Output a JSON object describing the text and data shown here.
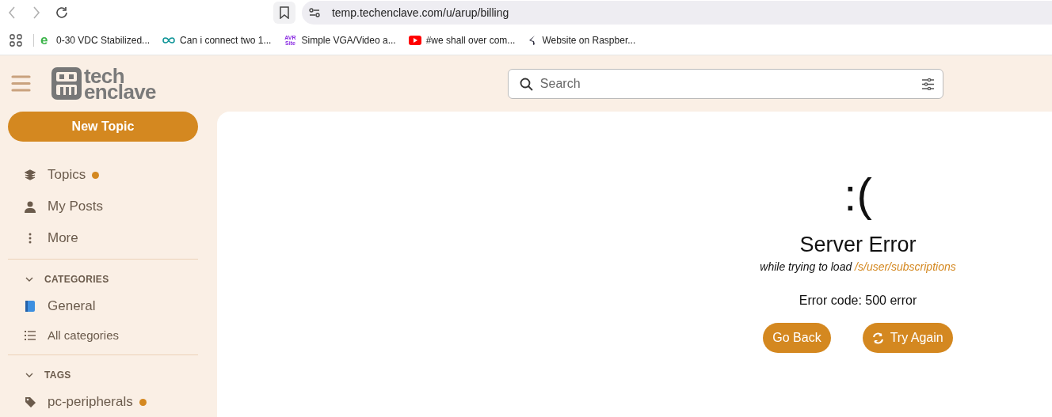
{
  "browser": {
    "url": "temp.techenclave.com/u/arup/billing"
  },
  "bookmarks": [
    {
      "kind": "letter",
      "icon_text": "e",
      "label": "0-30 VDC Stabilized..."
    },
    {
      "kind": "infinity",
      "label": "Can i connect two 1..."
    },
    {
      "kind": "letter2",
      "icon_text": "AVR Site",
      "label": "Simple VGA/Video a..."
    },
    {
      "kind": "play",
      "label": "#we shall over com..."
    },
    {
      "kind": "bird",
      "label": "Website on Raspber..."
    }
  ],
  "header": {
    "logo_top": "tech",
    "logo_bottom": "enclave",
    "search": {
      "placeholder": "Search"
    }
  },
  "sidebar": {
    "new_topic": "New Topic",
    "items": [
      {
        "kind": "layers",
        "label": "Topics",
        "unread": true
      },
      {
        "kind": "person",
        "label": "My Posts",
        "unread": false
      },
      {
        "kind": "dots",
        "label": "More",
        "unread": false
      }
    ],
    "sections": [
      {
        "title": "CATEGORIES",
        "expanded": true,
        "items": [
          {
            "kind": "book",
            "label": "General",
            "unread": false
          },
          {
            "kind": "list",
            "label": "All categories",
            "unread": false
          }
        ]
      },
      {
        "title": "TAGS",
        "expanded": true,
        "items": [
          {
            "kind": "tag",
            "label": "pc-peripherals",
            "unread": true
          }
        ]
      }
    ]
  },
  "error": {
    "face": ":(",
    "title": "Server Error",
    "message": "while trying to load",
    "path": "/s/user/subscriptions",
    "code": "Error code: 500 error",
    "buttons": [
      {
        "kind": "back",
        "label": "Go Back"
      },
      {
        "kind": "retry",
        "label": "Try Again"
      }
    ]
  }
}
